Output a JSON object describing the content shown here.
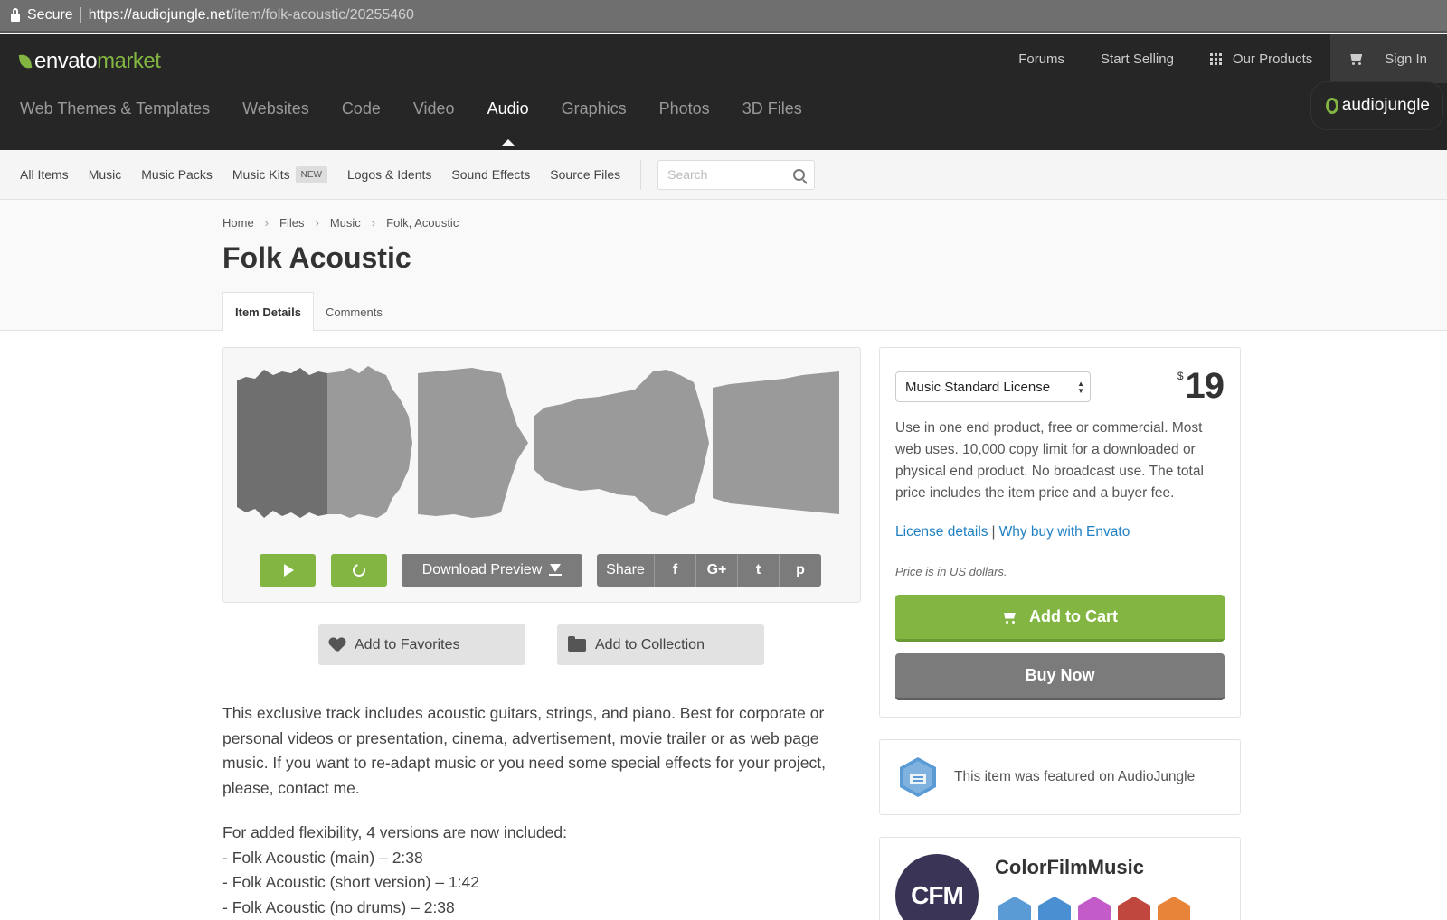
{
  "browser": {
    "secure_label": "Secure",
    "url_host": "https://audiojungle.net",
    "url_path": "/item/folk-acoustic/20255460"
  },
  "header": {
    "logo_envato": "envato",
    "logo_market": "market",
    "forums": "Forums",
    "start_selling": "Start Selling",
    "our_products": "Our Products",
    "sign_in": "Sign In",
    "categories": [
      "Web Themes & Templates",
      "Websites",
      "Code",
      "Video",
      "Audio",
      "Graphics",
      "Photos",
      "3D Files"
    ],
    "active_category": "Audio",
    "site_badge": "audiojungle"
  },
  "subnav": {
    "items": [
      "All Items",
      "Music",
      "Music Packs",
      "Music Kits",
      "Logos & Idents",
      "Sound Effects",
      "Source Files"
    ],
    "new_badge": "NEW",
    "search_placeholder": "Search"
  },
  "page": {
    "breadcrumb": [
      "Home",
      "Files",
      "Music",
      "Folk, Acoustic"
    ],
    "title": "Folk Acoustic",
    "tabs": [
      "Item Details",
      "Comments"
    ]
  },
  "player": {
    "download_label": "Download Preview",
    "share_label": "Share",
    "share_icons": [
      "facebook-icon",
      "google-plus-icon",
      "twitter-icon",
      "pinterest-icon"
    ],
    "share_glyphs": [
      "f",
      "G+",
      "t",
      "p"
    ]
  },
  "actions": {
    "favorites": "Add to Favorites",
    "collection": "Add to Collection"
  },
  "description": {
    "paragraph": "This exclusive track includes acoustic guitars, strings, and piano. Best for corporate or personal videos or presentation, cinema, advertisement, movie trailer or as web page music. If you want to re-adapt music or you need some special effects for your project, please, contact me.",
    "versions_intro": "For added flexibility, 4 versions are now included:",
    "versions": [
      "- Folk Acoustic (main) – 2:38",
      "- Folk Acoustic (short version) – 1:42",
      "- Folk Acoustic (no drums) – 2:38"
    ]
  },
  "purchase": {
    "license": "Music Standard License",
    "currency": "$",
    "price": "19",
    "license_desc": "Use in one end product, free or commercial. Most web uses. 10,000 copy limit for a downloaded or physical end product. No broadcast use. The total price includes the item price and a buyer fee.",
    "license_details": "License details",
    "why_buy": "Why buy with Envato",
    "price_note": "Price is in US dollars.",
    "add_to_cart": "Add to Cart",
    "buy_now": "Buy Now"
  },
  "featured": {
    "text": "This item was featured on AudioJungle"
  },
  "author": {
    "initials": "CFM",
    "name": "ColorFilmMusic",
    "badge_colors": [
      "#5b9bd5",
      "#4a8fd1",
      "#c35bc8",
      "#c0473e",
      "#e8843a"
    ]
  },
  "colors": {
    "accent_green": "#82b541",
    "header_dark": "#262626",
    "button_gray": "#7b7b7b",
    "link_blue": "#1f80c3"
  }
}
